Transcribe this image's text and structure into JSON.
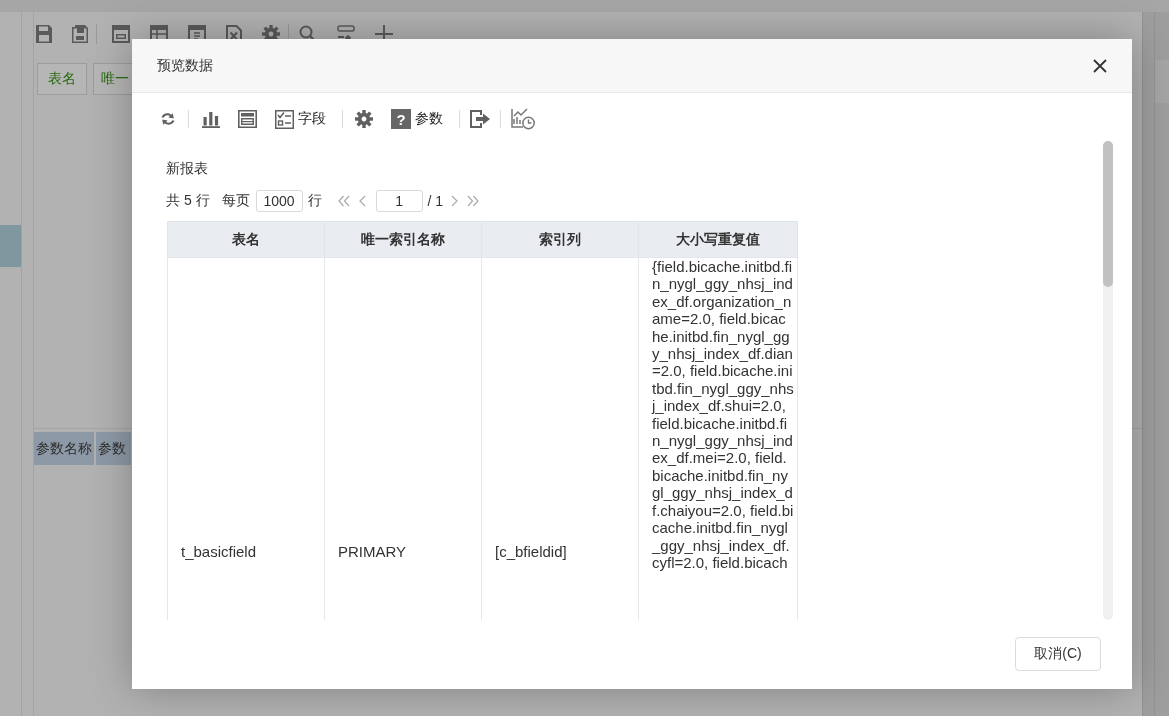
{
  "background": {
    "navigator": {
      "items": [
        {
          "selected": true
        }
      ]
    },
    "field_tags": [
      {
        "label": "表名"
      },
      {
        "label": "唯一"
      }
    ],
    "parameter_table": {
      "columns": [
        "参数名称",
        "参数"
      ]
    }
  },
  "dialog": {
    "title": "预览数据",
    "toolbar": {
      "fields_label": "字段",
      "help_glyph": "?",
      "parameters_label": "参数"
    },
    "report_title": "新报表",
    "pagination": {
      "total": "共 5 行",
      "per_page_label": "每页",
      "per_page": "1000",
      "per_page_unit": "行",
      "page": "1",
      "page_count": "/ 1"
    },
    "table": {
      "columns": [
        "表名",
        "唯一索引名称",
        "索引列",
        "大小写重复值"
      ],
      "rows": [
        [
          "t_basicfield",
          "PRIMARY",
          "[c_bfieldid]",
          "{field.bicache.initbd.fin_nygl_ggy_nhsj_index_df.organization_name=2.0, field.bicache.initbd.fin_nygl_ggy_nhsj_index_df.dian=2.0, field.bicache.initbd.fin_nygl_ggy_nhsj_index_df.shui=2.0, field.bicache.initbd.fin_nygl_ggy_nhsj_index_df.mei=2.0, field.bicache.initbd.fin_nygl_ggy_nhsj_index_df.chaiyou=2.0, field.bicache.initbd.fin_nygl_ggy_nhsj_index_df.cyfl=2.0, field.bicach"
        ]
      ]
    },
    "buttons": [
      {
        "label": "取消(C)"
      }
    ]
  }
}
